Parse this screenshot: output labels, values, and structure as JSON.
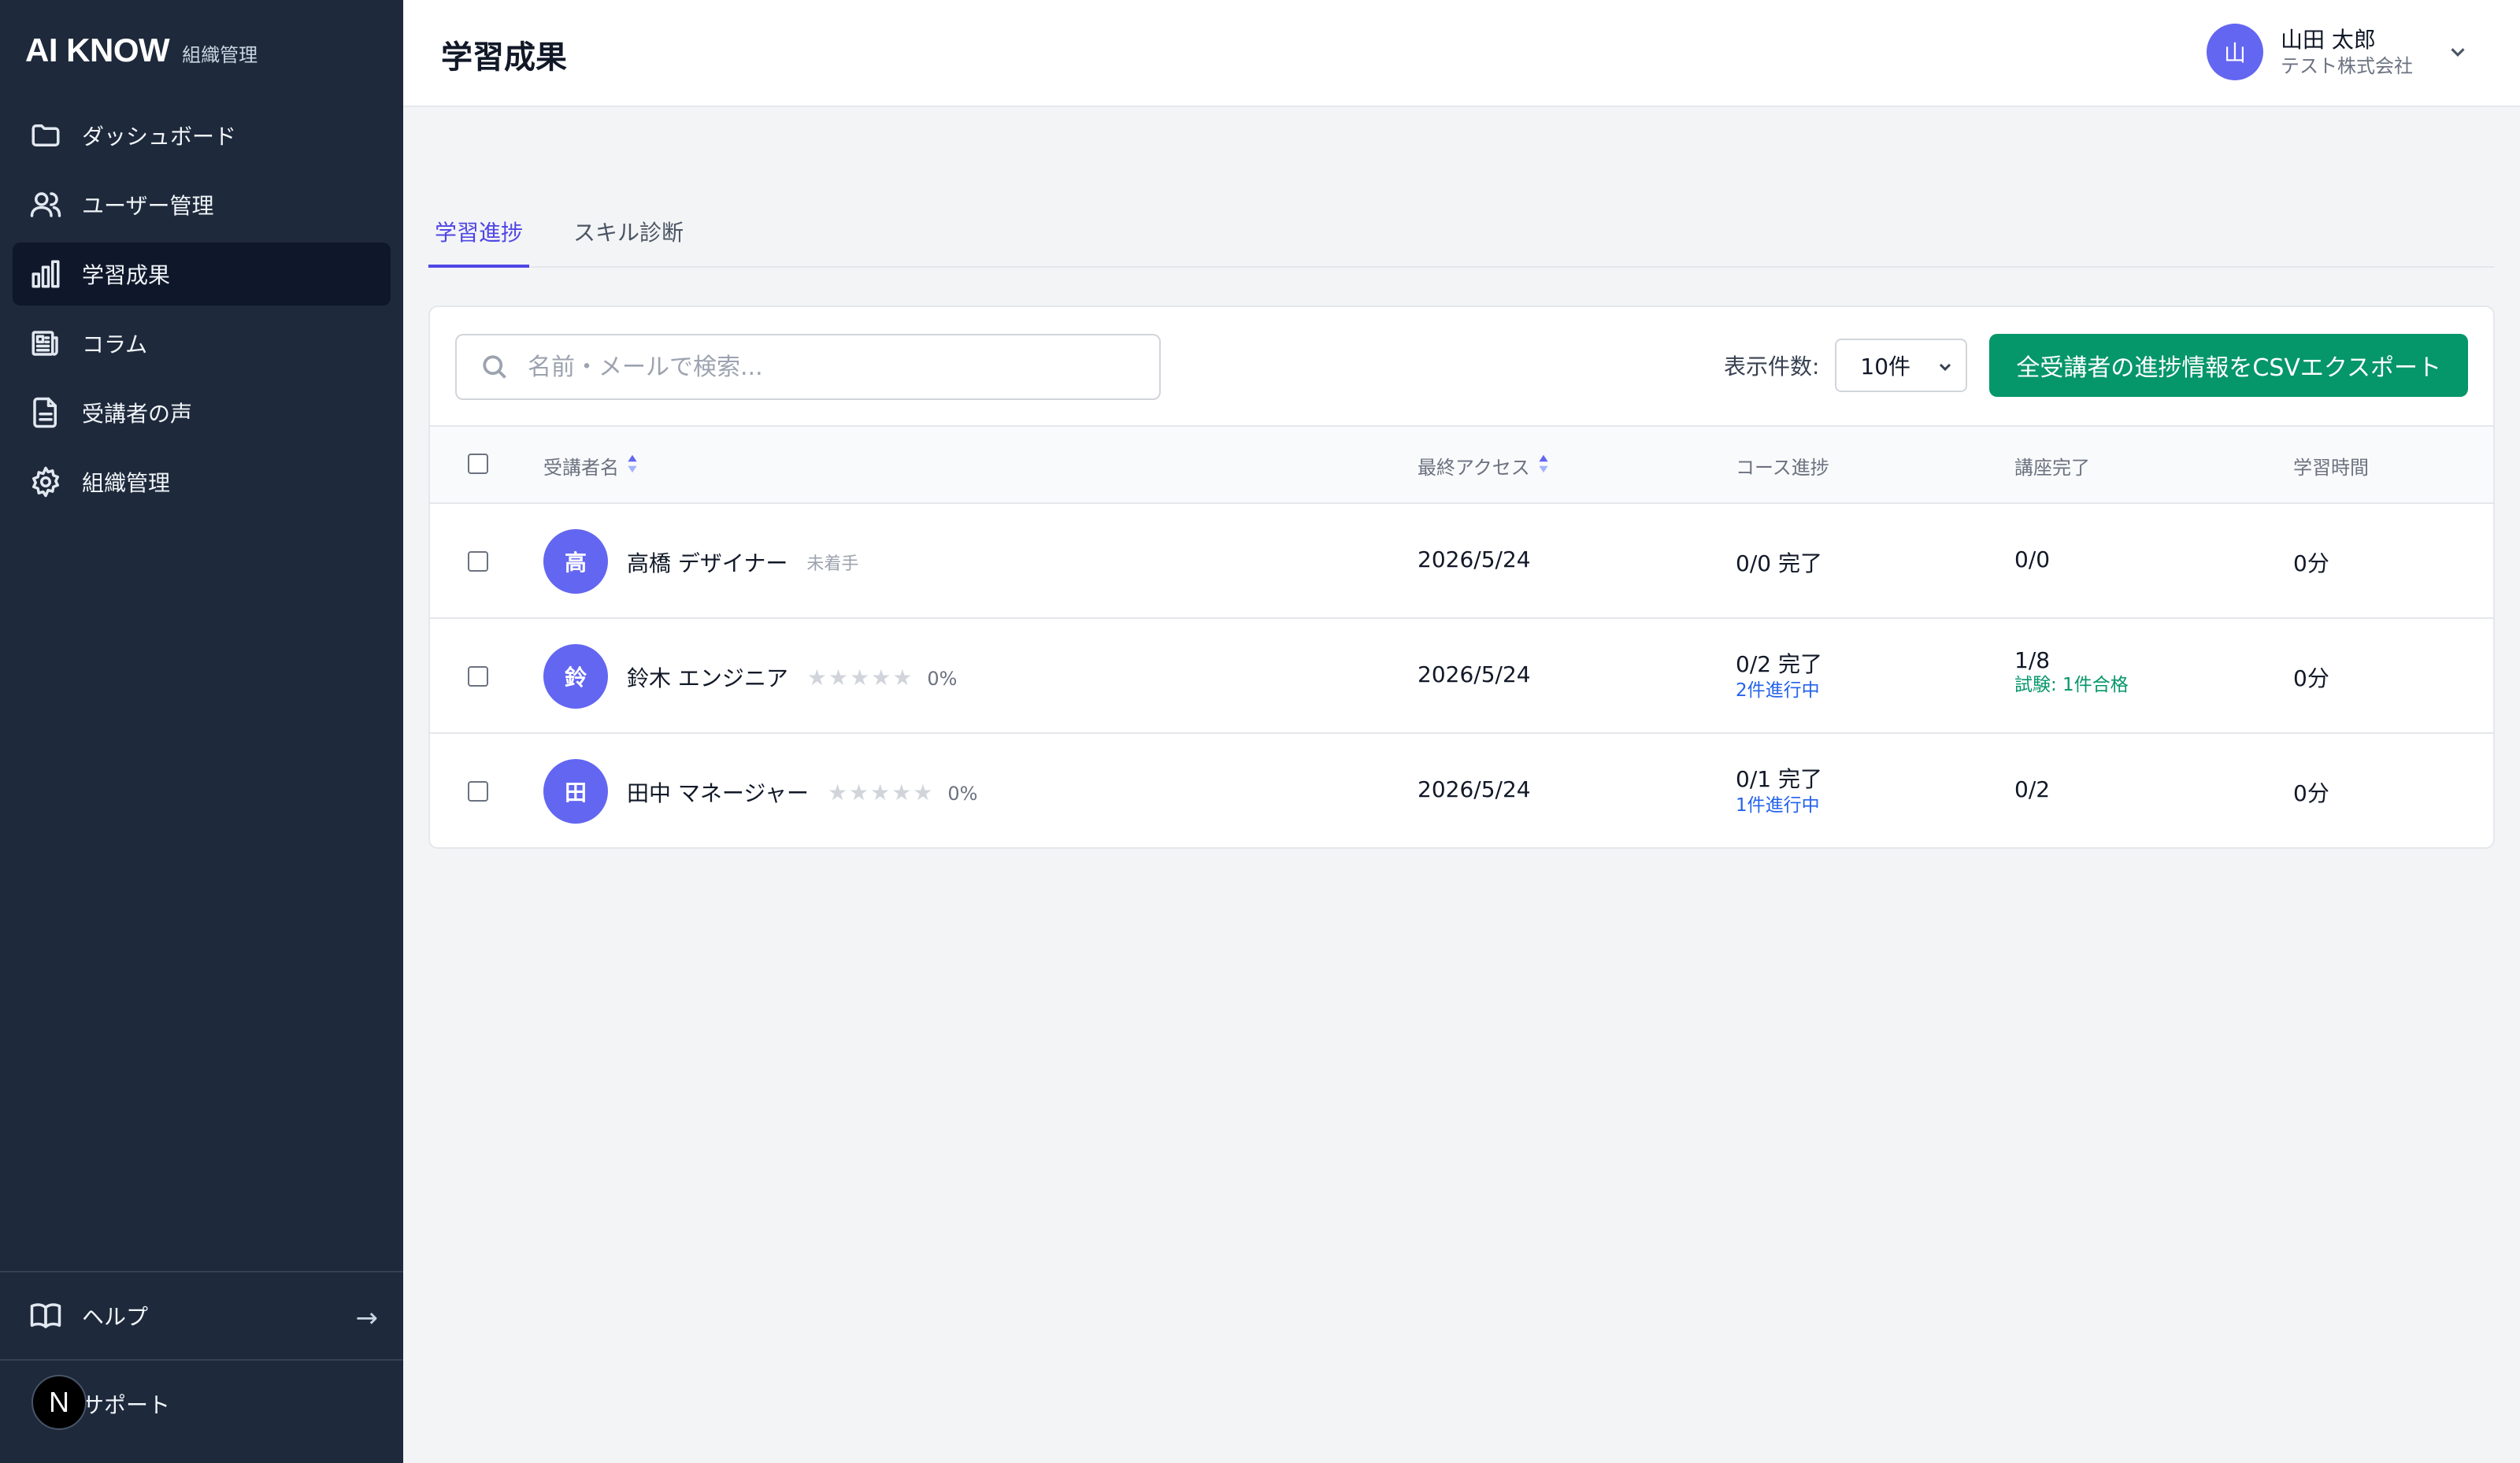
{
  "sidebar": {
    "brand": "AI KNOW",
    "brand_sub": "組織管理",
    "items": [
      {
        "label": "ダッシュボード"
      },
      {
        "label": "ユーザー管理"
      },
      {
        "label": "学習成果"
      },
      {
        "label": "コラム"
      },
      {
        "label": "受講者の声"
      },
      {
        "label": "組織管理"
      }
    ],
    "help": "ヘルプ",
    "support": "サポート",
    "n_badge": "N"
  },
  "header": {
    "title": "学習成果",
    "user_initial": "山",
    "user_name": "山田 太郎",
    "user_company": "テスト株式会社"
  },
  "tabs": [
    {
      "label": "学習進捗"
    },
    {
      "label": "スキル診断"
    }
  ],
  "toolbar": {
    "search_placeholder": "名前・メールで検索...",
    "per_page_label": "表示件数:",
    "per_page_value": "10件",
    "export_label": "全受講者の進捗情報をCSVエクスポート"
  },
  "table": {
    "columns": {
      "name": "受講者名",
      "last_access": "最終アクセス",
      "course": "コース進捗",
      "lecture": "講座完了",
      "time": "学習時間"
    },
    "rows": [
      {
        "initial": "高",
        "name": "高橋 デザイナー",
        "status": "未着手",
        "stars": "",
        "pct": "",
        "last_access": "2026/5/24",
        "course": "0/0 完了",
        "course_sub": "",
        "lecture": "0/0",
        "lecture_sub": "",
        "time": "0分"
      },
      {
        "initial": "鈴",
        "name": "鈴木 エンジニア",
        "status": "",
        "stars": "★★★★★",
        "pct": "0%",
        "last_access": "2026/5/24",
        "course": "0/2 完了",
        "course_sub": "2件進行中",
        "lecture": "1/8",
        "lecture_sub": "試験: 1件合格",
        "time": "0分"
      },
      {
        "initial": "田",
        "name": "田中 マネージャー",
        "status": "",
        "stars": "★★★★★",
        "pct": "0%",
        "last_access": "2026/5/24",
        "course": "0/1 完了",
        "course_sub": "1件進行中",
        "lecture": "0/2",
        "lecture_sub": "",
        "time": "0分"
      }
    ]
  },
  "colors": {
    "sidebar_bg": "#1e293b",
    "accent": "#4f46e5",
    "export_green": "#059669",
    "avatar": "#6366f1"
  }
}
